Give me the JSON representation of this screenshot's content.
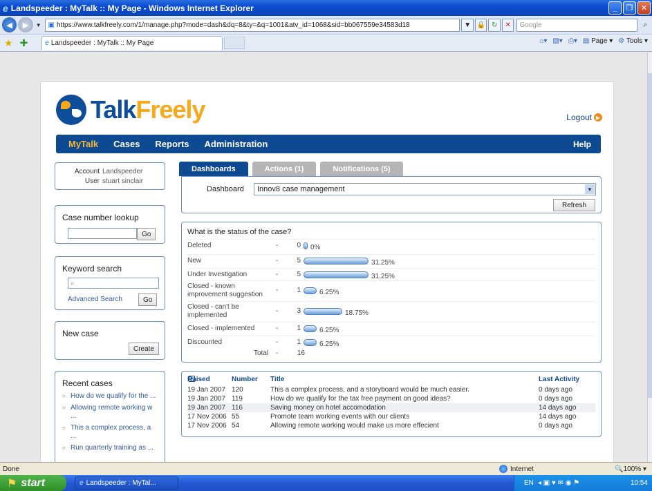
{
  "window": {
    "title": "Landspeeder : MyTalk :: My Page - Windows Internet Explorer",
    "url": "https://www.talkfreely.com/1/manage.php?mode=dash&dq=8&ty=&q=1001&atv_id=1068&sid=bb067559e34583d18",
    "search_placeholder": "Google",
    "tab_label": "Landspeeder : MyTalk :: My Page",
    "cmd_page": "Page",
    "cmd_tools": "Tools"
  },
  "header": {
    "logo_talk": "Talk",
    "logo_freely": "Freely",
    "logout": "Logout"
  },
  "nav": {
    "items": [
      "MyTalk",
      "Cases",
      "Reports",
      "Administration"
    ],
    "help": "Help"
  },
  "account": {
    "account_label": "Account",
    "account_value": "Landspeeder",
    "user_label": "User",
    "user_value": "stuart sinclair"
  },
  "case_lookup": {
    "title": "Case number lookup",
    "go": "Go"
  },
  "keyword_search": {
    "title": "Keyword search",
    "advanced": "Advanced Search",
    "go": "Go"
  },
  "new_case": {
    "title": "New case",
    "create": "Create"
  },
  "recent_cases": {
    "title": "Recent cases",
    "items": [
      "How do we qualify for the ...",
      "Allowing remote working w ...",
      "This a complex process, a ...",
      "Run quarterly training as ..."
    ]
  },
  "dashboard_tabs": [
    "Dashboards",
    "Actions (1)",
    "Notifications (5)"
  ],
  "dashboard": {
    "label": "Dashboard",
    "selected": "Innov8 case management",
    "refresh": "Refresh"
  },
  "status": {
    "title": "What is the status of the case?",
    "rows": [
      {
        "label": "Deleted",
        "dash": "-",
        "count": "0",
        "pct": "0%",
        "fraction": 0
      },
      {
        "label": "New",
        "dash": "-",
        "count": "5",
        "pct": "31.25%",
        "fraction": 0.3125
      },
      {
        "label": "Under Investigation",
        "dash": "-",
        "count": "5",
        "pct": "31.25%",
        "fraction": 0.3125
      },
      {
        "label": "Closed - known improvement suggestion",
        "dash": "-",
        "count": "1",
        "pct": "6.25%",
        "fraction": 0.0625
      },
      {
        "label": "Closed - can't be implemented",
        "dash": "-",
        "count": "3",
        "pct": "18.75%",
        "fraction": 0.1875
      },
      {
        "label": "Closed - implemented",
        "dash": "-",
        "count": "1",
        "pct": "6.25%",
        "fraction": 0.0625
      },
      {
        "label": "Discounted",
        "dash": "-",
        "count": "1",
        "pct": "6.25%",
        "fraction": 0.0625
      }
    ],
    "total_label": "Total",
    "total_dash": "-",
    "total_value": "16"
  },
  "cases_table": {
    "headers": {
      "raised": "Raised",
      "number": "Number",
      "title": "Title",
      "last_activity": "Last Activity"
    },
    "rows": [
      {
        "raised": "19 Jan 2007",
        "number": "120",
        "title": "This a complex process, and a storyboard would be much easier.",
        "last": "0 days ago"
      },
      {
        "raised": "19 Jan 2007",
        "number": "119",
        "title": "How do we qualify for the tax free payment on good ideas?",
        "last": "0 days ago"
      },
      {
        "raised": "19 Jan 2007",
        "number": "116",
        "title": "Saving money on hotel accomodation",
        "last": "14 days ago"
      },
      {
        "raised": "17 Nov 2006",
        "number": "55",
        "title": "Promote team working events with our clients",
        "last": "14 days ago"
      },
      {
        "raised": "17 Nov 2006",
        "number": "54",
        "title": "Allowing remote working would make us more effecient",
        "last": "0 days ago"
      }
    ]
  },
  "statusbar": {
    "done": "Done",
    "zone": "Internet",
    "zoom": "100%"
  },
  "taskbar": {
    "start": "start",
    "item": "Landspeeder : MyTal...",
    "lang": "EN",
    "clock": "10:54"
  }
}
